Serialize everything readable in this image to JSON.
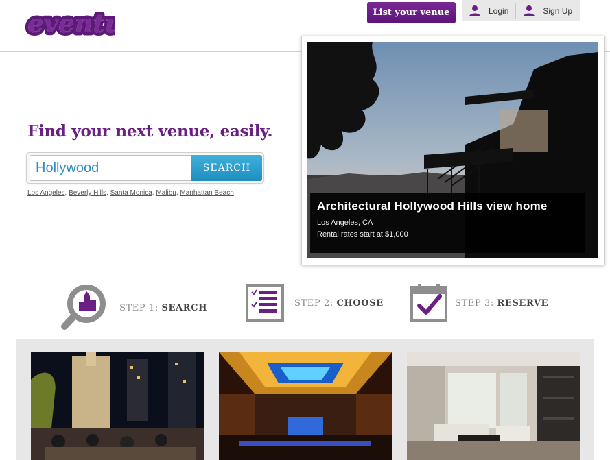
{
  "header": {
    "logo_text": "eventup",
    "list_venue_label": "List your venue",
    "login_label": "Login",
    "signup_label": "Sign Up"
  },
  "hero": {
    "tagline": "Find your next venue, easily.",
    "search": {
      "value": "Hollywood",
      "button_label": "SEARCH"
    },
    "quick_links": [
      "Los Angeles",
      "Beverly Hills",
      "Santa Monica",
      "Malibu",
      "Manhattan Beach"
    ]
  },
  "featured": {
    "title": "Architectural Hollywood Hills view home",
    "location": "Los Angeles, CA",
    "rate": "Rental rates start at $1,000"
  },
  "steps": [
    {
      "prefix": "STEP 1:",
      "label": "SEARCH"
    },
    {
      "prefix": "STEP 2:",
      "label": "CHOOSE"
    },
    {
      "prefix": "STEP 3:",
      "label": "RESERVE"
    }
  ],
  "colors": {
    "brand_purple": "#6a1f82",
    "search_blue": "#2a97cc",
    "icon_gray": "#8e8e8e",
    "gallery_bg": "#e7e7e7"
  },
  "icons": {
    "user": "user-icon",
    "search_step": "magnifier-building-icon",
    "choose_step": "checklist-icon",
    "reserve_step": "calendar-check-icon"
  }
}
